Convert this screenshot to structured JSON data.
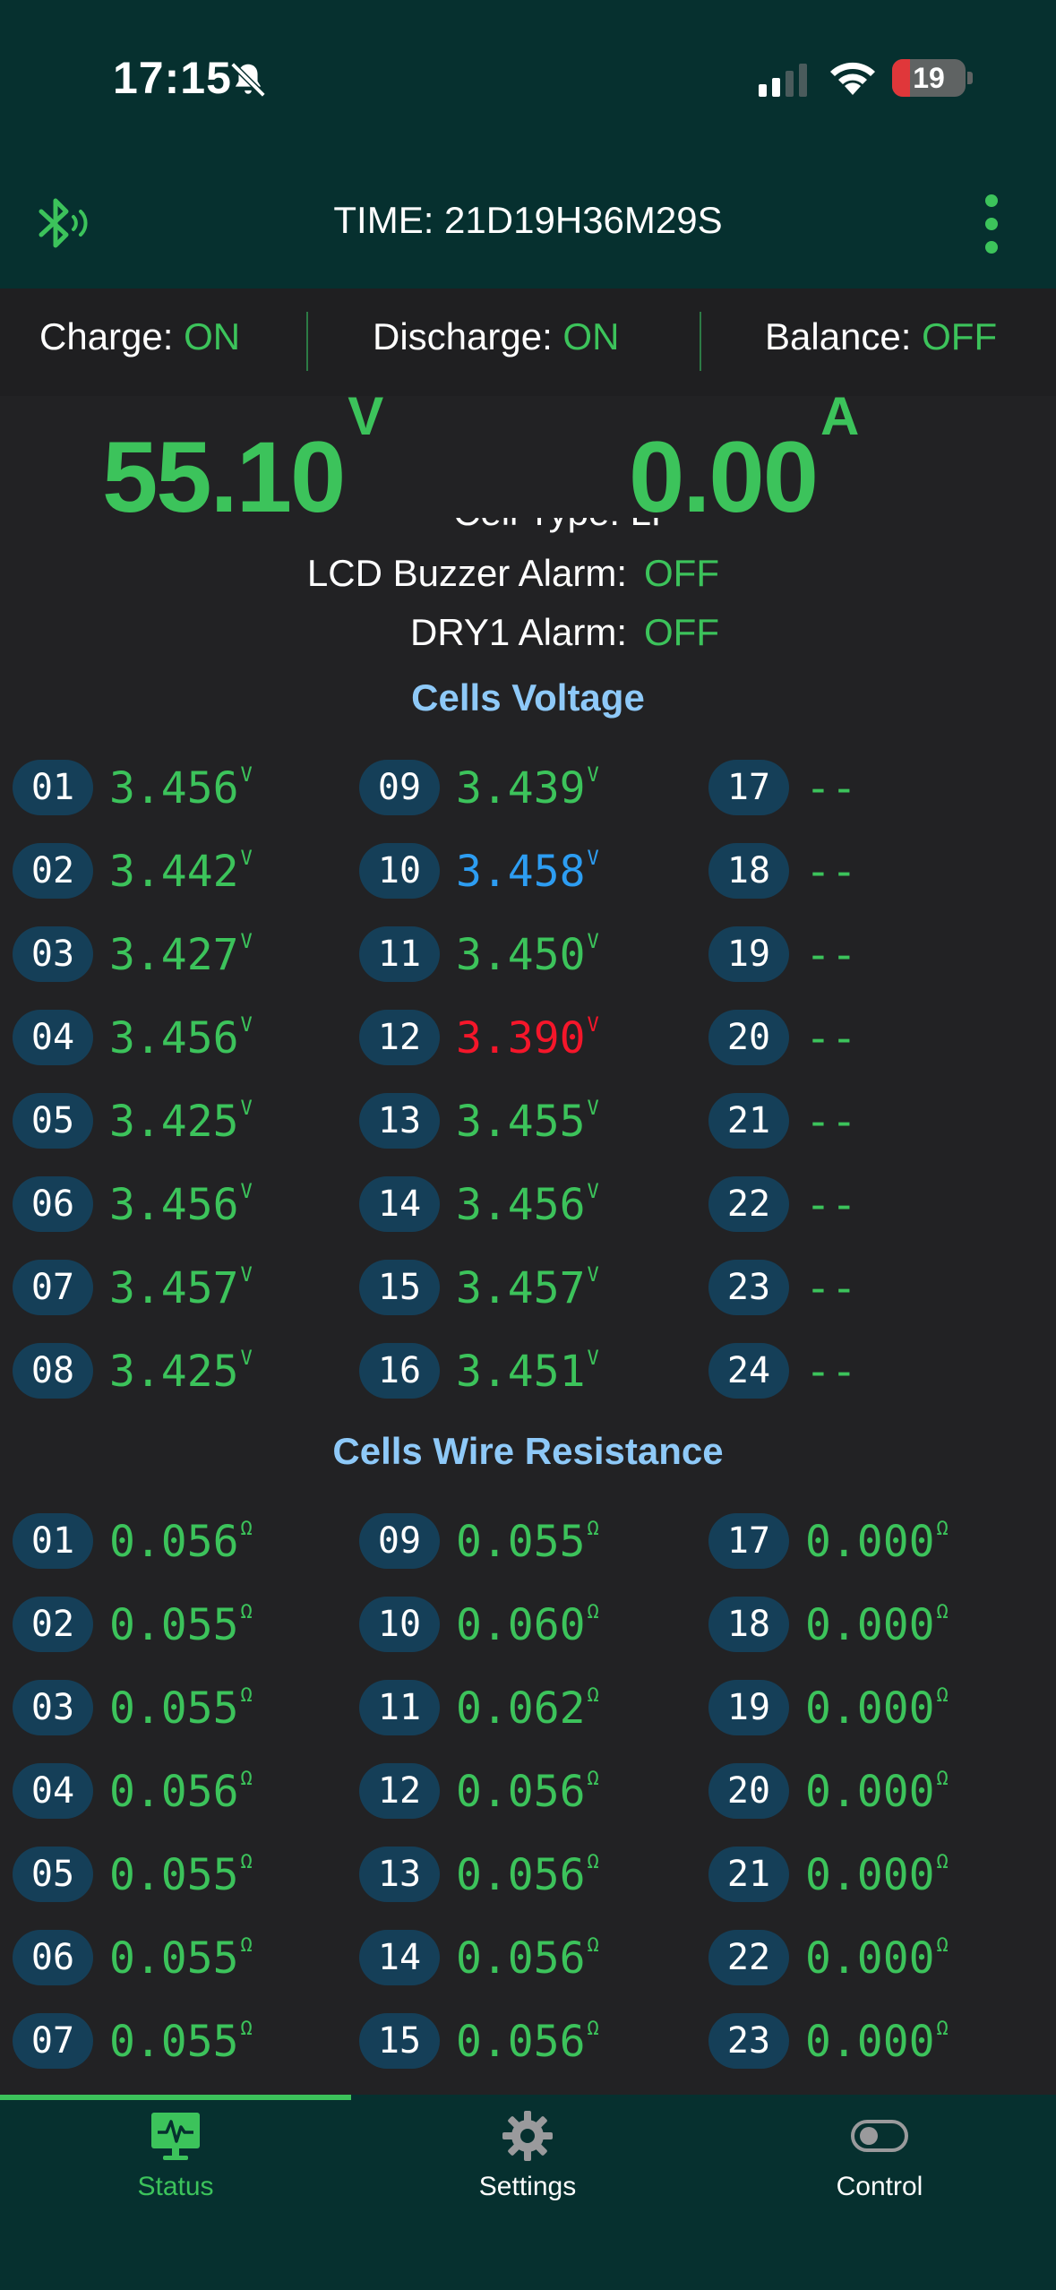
{
  "status_bar": {
    "time": "17:15",
    "battery": "19"
  },
  "header": {
    "time_label": "TIME: 21D19H36M29S"
  },
  "switches": {
    "charge": {
      "label": "Charge: ",
      "value": "ON"
    },
    "discharge": {
      "label": "Discharge: ",
      "value": "ON"
    },
    "balance": {
      "label": "Balance: ",
      "value": "OFF"
    }
  },
  "readings": {
    "voltage": {
      "value": "55.10",
      "unit": "V"
    },
    "current": {
      "value": "0.00",
      "unit": "A"
    }
  },
  "info": {
    "cell_type_partial": "Cell Type:  LF",
    "lcd_buzzer": {
      "label": "LCD Buzzer Alarm:",
      "value": "OFF"
    },
    "dry1": {
      "label": "DRY1 Alarm:",
      "value": "OFF"
    }
  },
  "cells_voltage": {
    "title": "Cells Voltage",
    "unit": "V",
    "cells": [
      {
        "id": "01",
        "value": "3.456"
      },
      {
        "id": "02",
        "value": "3.442"
      },
      {
        "id": "03",
        "value": "3.427"
      },
      {
        "id": "04",
        "value": "3.456"
      },
      {
        "id": "05",
        "value": "3.425"
      },
      {
        "id": "06",
        "value": "3.456"
      },
      {
        "id": "07",
        "value": "3.457"
      },
      {
        "id": "08",
        "value": "3.425"
      },
      {
        "id": "09",
        "value": "3.439"
      },
      {
        "id": "10",
        "value": "3.458",
        "status": "max"
      },
      {
        "id": "11",
        "value": "3.450"
      },
      {
        "id": "12",
        "value": "3.390",
        "status": "min"
      },
      {
        "id": "13",
        "value": "3.455"
      },
      {
        "id": "14",
        "value": "3.456"
      },
      {
        "id": "15",
        "value": "3.457"
      },
      {
        "id": "16",
        "value": "3.451"
      },
      {
        "id": "17",
        "value": "--"
      },
      {
        "id": "18",
        "value": "--"
      },
      {
        "id": "19",
        "value": "--"
      },
      {
        "id": "20",
        "value": "--"
      },
      {
        "id": "21",
        "value": "--"
      },
      {
        "id": "22",
        "value": "--"
      },
      {
        "id": "23",
        "value": "--"
      },
      {
        "id": "24",
        "value": "--"
      }
    ]
  },
  "cells_resistance": {
    "title": "Cells Wire Resistance",
    "unit": "Ω",
    "cells": [
      {
        "id": "01",
        "value": "0.056"
      },
      {
        "id": "02",
        "value": "0.055"
      },
      {
        "id": "03",
        "value": "0.055"
      },
      {
        "id": "04",
        "value": "0.056"
      },
      {
        "id": "05",
        "value": "0.055"
      },
      {
        "id": "06",
        "value": "0.055"
      },
      {
        "id": "07",
        "value": "0.055"
      },
      {
        "id": "09",
        "value": "0.055"
      },
      {
        "id": "10",
        "value": "0.060"
      },
      {
        "id": "11",
        "value": "0.062"
      },
      {
        "id": "12",
        "value": "0.056"
      },
      {
        "id": "13",
        "value": "0.056"
      },
      {
        "id": "14",
        "value": "0.056"
      },
      {
        "id": "15",
        "value": "0.056"
      },
      {
        "id": "17",
        "value": "0.000"
      },
      {
        "id": "18",
        "value": "0.000"
      },
      {
        "id": "19",
        "value": "0.000"
      },
      {
        "id": "20",
        "value": "0.000"
      },
      {
        "id": "21",
        "value": "0.000"
      },
      {
        "id": "22",
        "value": "0.000"
      },
      {
        "id": "23",
        "value": "0.000"
      }
    ]
  },
  "nav": [
    {
      "label": "Status",
      "icon": "monitor-pulse-icon",
      "active": true
    },
    {
      "label": "Settings",
      "icon": "gear-icon",
      "active": false
    },
    {
      "label": "Control",
      "icon": "toggle-icon",
      "active": false
    }
  ],
  "colors": {
    "accent": "#3cc35b",
    "header_bg": "#06302f",
    "badge_bg": "#153f58",
    "max_value": "#2d9df2",
    "min_value": "#f5162a"
  }
}
